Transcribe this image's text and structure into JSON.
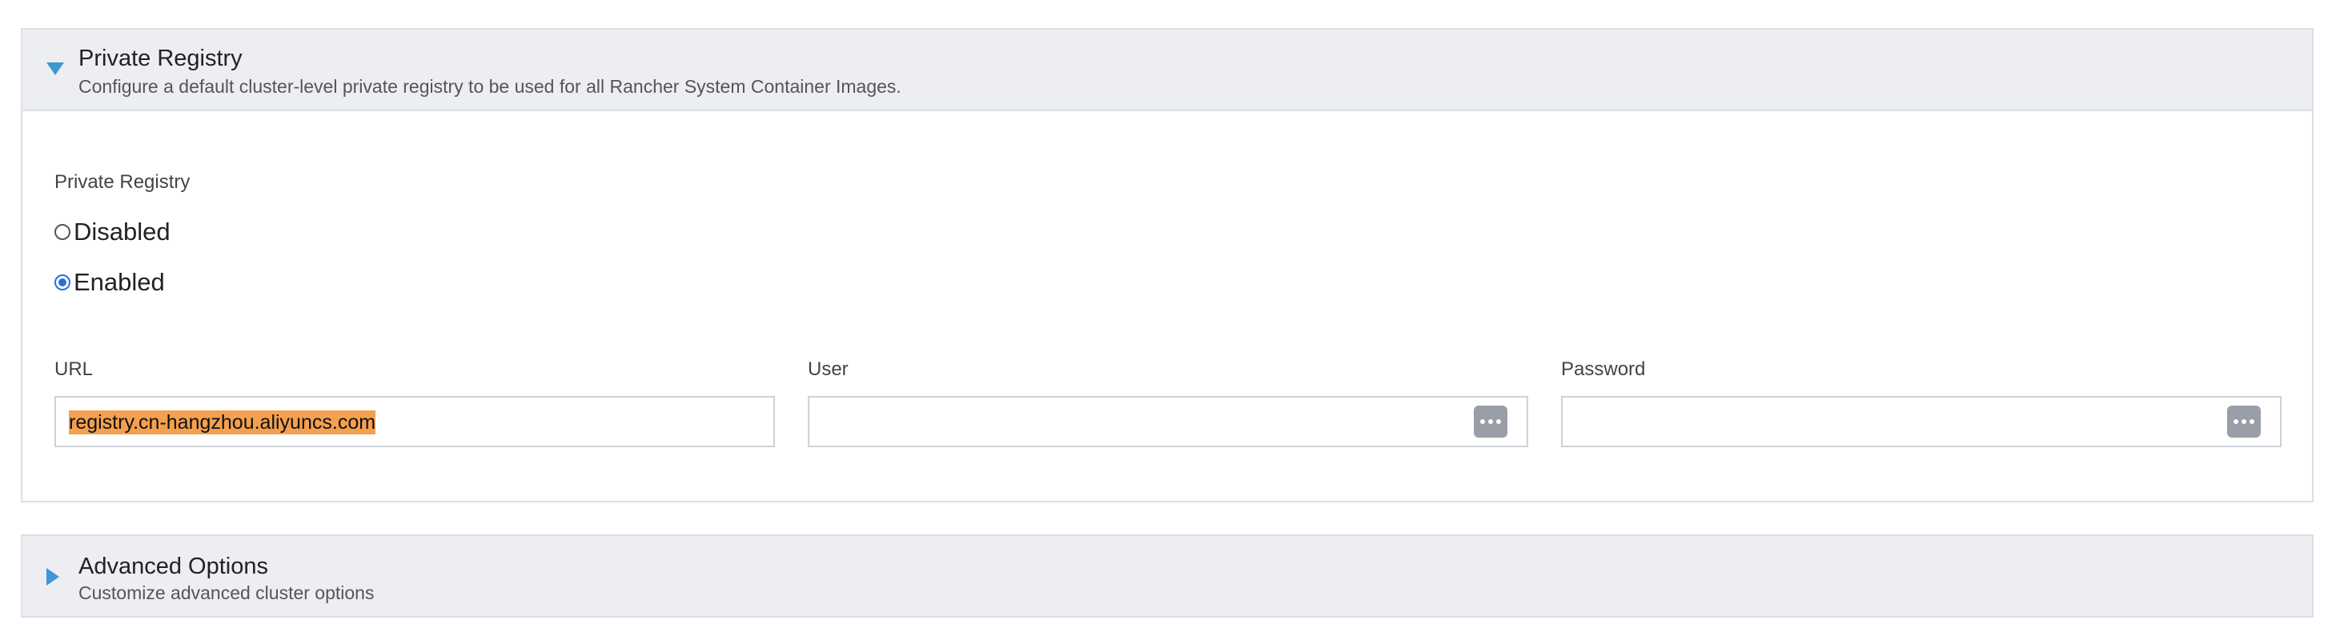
{
  "private_registry_section": {
    "title": "Private Registry",
    "description": "Configure a default cluster-level private registry to be used for all Rancher System Container Images.",
    "expanded": true,
    "group_label": "Private Registry",
    "options": [
      {
        "label": "Disabled",
        "selected": false
      },
      {
        "label": "Enabled",
        "selected": true
      }
    ],
    "url": {
      "label": "URL",
      "value": "registry.cn-hangzhou.aliyuncs.com"
    },
    "user": {
      "label": "User",
      "value": ""
    },
    "password": {
      "label": "Password",
      "value": ""
    }
  },
  "advanced_options_section": {
    "title": "Advanced Options",
    "description": "Customize advanced cluster options",
    "expanded": false
  },
  "colors": {
    "accent": "#3d98d3",
    "header_bg": "#edeef2",
    "selection_highlight": "#f4a04e",
    "radio_checked": "#2c6ed9"
  },
  "icons": {
    "expanded_caret": "caret-down-icon",
    "collapsed_caret": "caret-right-icon",
    "password_manager": "password-manager-icon"
  }
}
